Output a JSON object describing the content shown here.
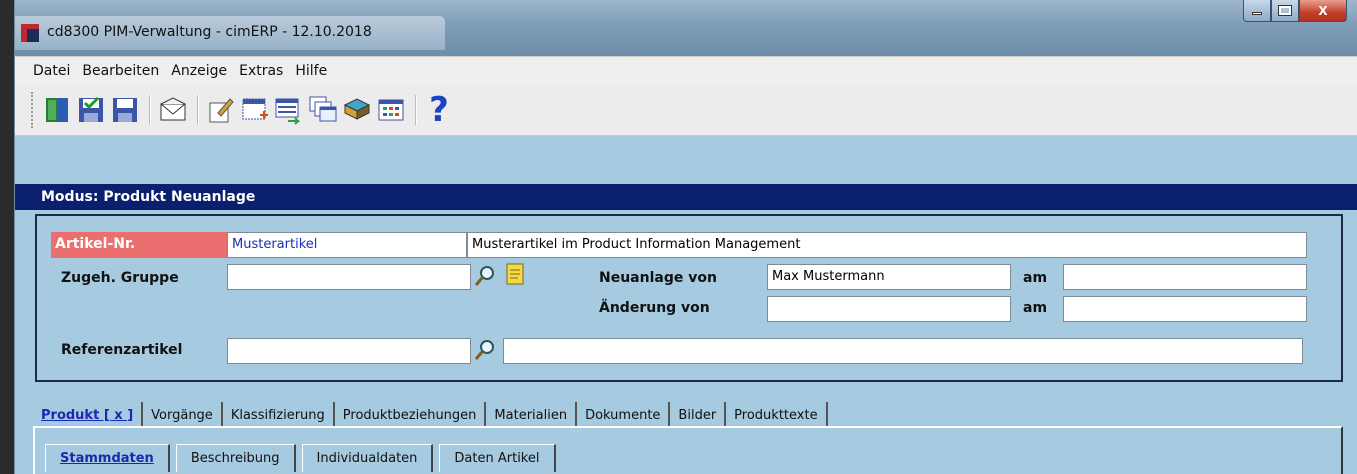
{
  "window": {
    "title": "cd8300 PIM-Verwaltung - cimERP - 12.10.2018",
    "buttons": {
      "close": "X"
    }
  },
  "menu": [
    "Datei",
    "Bearbeiten",
    "Anzeige",
    "Extras",
    "Hilfe"
  ],
  "toolbar": {
    "help_glyph": "?"
  },
  "mode": {
    "text": "Modus: Produkt Neuanlage"
  },
  "form": {
    "artikel_nr_label": "Artikel-Nr.",
    "artikel_nr_value": "Musterartikel",
    "artikel_desc_value": "Musterartikel im Product Information Management",
    "gruppe_label": "Zugeh. Gruppe",
    "gruppe_value": "",
    "neuanlage_label": "Neuanlage von",
    "neuanlage_value": "Max Mustermann",
    "am_label_1": "am",
    "am_value_1": "",
    "aenderung_label": "Änderung von",
    "aenderung_value": "",
    "am_label_2": "am",
    "am_value_2": "",
    "referenz_label": "Referenzartikel",
    "referenz_value": "",
    "referenz_desc_value": ""
  },
  "tabs_main": [
    "Produkt [ x ]",
    "Vorgänge",
    "Klassifizierung",
    "Produktbeziehungen",
    "Materialien",
    "Dokumente",
    "Bilder",
    "Produkttexte"
  ],
  "tabs_sub": [
    "Stammdaten",
    "Beschreibung",
    "Individualdaten",
    "Daten Artikel"
  ],
  "colors": {
    "mode_bar": "#0a1f6e",
    "background": "#a6cae0",
    "label_highlight": "#ec6f6f",
    "link_blue": "#1d28b0"
  }
}
